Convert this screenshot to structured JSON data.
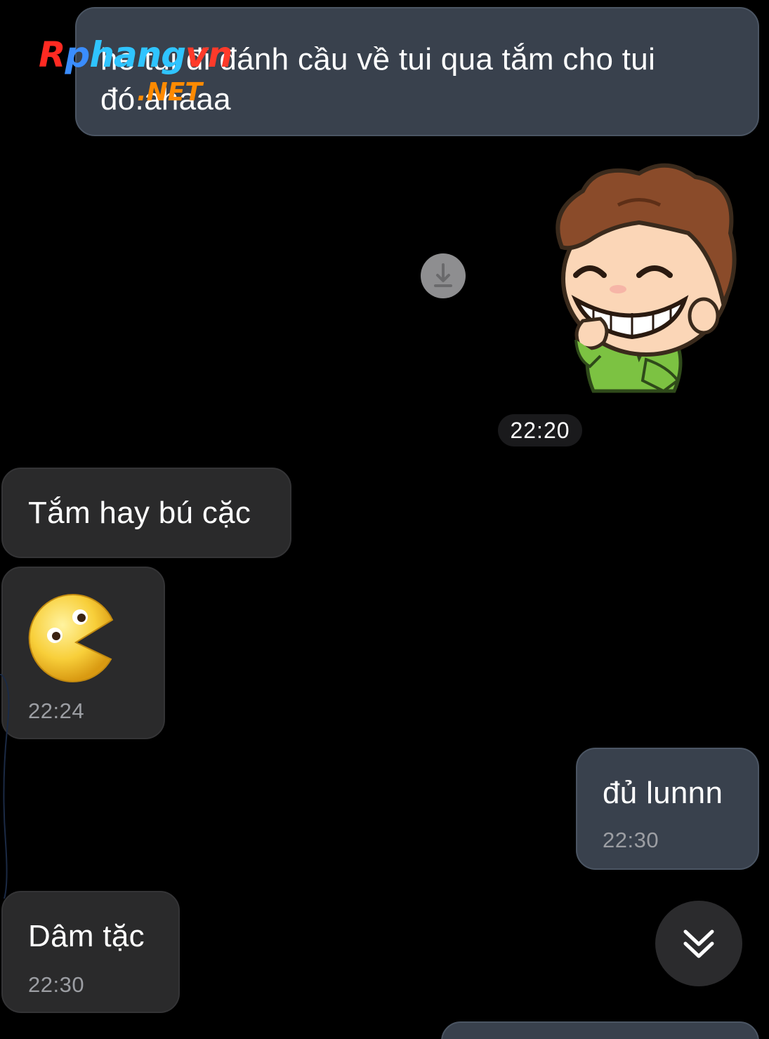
{
  "watermark": {
    "brand_r": "R",
    "brand_p": "p",
    "brand_hang": "hang",
    "brand_vn": "vn",
    "brand_net": ".NET"
  },
  "messages": [
    {
      "id": "b1",
      "direction": "outgoing",
      "text": "Hà tui đi đánh cầu về tui qua tắm cho tui đó...",
      "visible_text": "hè tui đi đánh cầu về tui qua tắm cho tui đó.ahaaa"
    },
    {
      "id": "sticker",
      "direction": "outgoing",
      "type": "sticker",
      "sticker_icon": "grinning-boy-sticker",
      "time": "22:20"
    },
    {
      "id": "b2",
      "direction": "incoming",
      "text": "Tắm hay bú cặc"
    },
    {
      "id": "b3",
      "direction": "incoming",
      "type": "emoji",
      "emoji_icon": "pacman-emoji",
      "time": "22:24"
    },
    {
      "id": "b4",
      "direction": "outgoing",
      "text": "đủ lunnn",
      "time": "22:30"
    },
    {
      "id": "b5",
      "direction": "incoming",
      "text": "Dâm tặc",
      "time": "22:30"
    }
  ],
  "b1_text": "hè tui đi đánh cầu về tui qua tắm cho tui đó.ahaaa",
  "sticker_time": "22:20",
  "b2_text": "Tắm hay bú cặc",
  "b3_time": "22:24",
  "b4_text": "đủ lunnn",
  "b4_time": "22:30",
  "b5_text": "Dâm tặc",
  "b5_time": "22:30",
  "icons": {
    "download": "download-icon",
    "scroll_down": "double-chevron-down-icon"
  },
  "colors": {
    "background": "#000000",
    "outgoing_bubble": "#39414d",
    "incoming_bubble": "#2a2a2b",
    "time_text": "#9c9ea3"
  }
}
